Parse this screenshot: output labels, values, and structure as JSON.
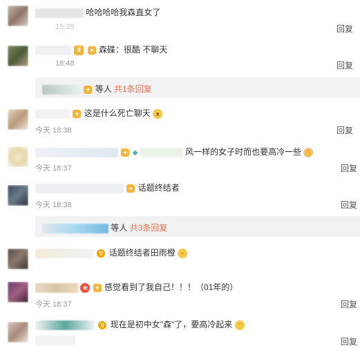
{
  "reply_label": "回复",
  "comments": [
    {
      "user": "",
      "text": "哈哈哈哈我森直女了",
      "time": "15:39"
    },
    {
      "user": "",
      "text": "森碟：很酷 不聊天",
      "time": "18:48"
    },
    {
      "user": "",
      "text": "这是什么死亡聊天",
      "time": "今天 18:38"
    },
    {
      "user": "",
      "text": "风一样的女子时而也要高冷一些",
      "time": "今天 18:37"
    },
    {
      "user": "",
      "text": "话题终结者",
      "time": "今天 18:38"
    },
    {
      "user": "",
      "text": "话题终结者田雨橙",
      "time": ""
    },
    {
      "user": "",
      "text": "感觉看到了我自己！！！（01年的）",
      "time": "今天 18:37"
    },
    {
      "user": "",
      "text": "现在是初中女\"森\"了，要高冷起来",
      "time": ""
    }
  ],
  "sub_replies": [
    {
      "who": "",
      "text": "等人",
      "link": "共1条回复"
    },
    {
      "who": "",
      "text": "等人",
      "link": "共3条回复"
    }
  ],
  "icons": {
    "vip_badge": "crown-badge-icon",
    "verified_badge": "v-verified-icon",
    "emoji": "emoji-icon"
  },
  "colors": {
    "link": "#eb7350",
    "time": "#999999",
    "subbar_bg": "#f2f2f5"
  }
}
